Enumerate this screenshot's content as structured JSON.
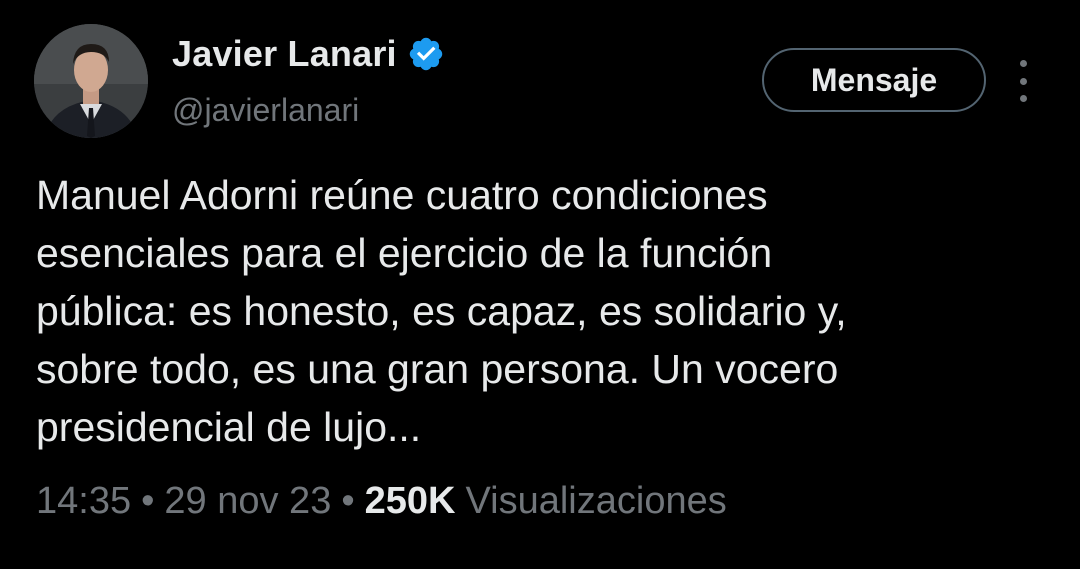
{
  "author": {
    "display_name": "Javier Lanari",
    "handle": "@javierlanari",
    "verified_icon": "verified-badge-icon",
    "avatar_icon": "profile-avatar"
  },
  "actions": {
    "message_label": "Mensaje",
    "more_icon": "more-options-icon"
  },
  "tweet": {
    "text": "Manuel Adorni reúne cuatro condiciones\nesenciales para el ejercicio de la función\npública: es honesto, es capaz, es solidario y,\nsobre todo, es una gran persona. Un vocero\npresidencial de lujo...",
    "time": "14:35",
    "separator": "•",
    "date": "29 nov 23",
    "views_count": "250K",
    "views_label": "Visualizaciones"
  },
  "colors": {
    "background": "#000000",
    "primary_text": "#e7e9ea",
    "secondary_text": "#71767b",
    "verified_blue": "#1d9bf0",
    "button_border": "#536471"
  }
}
